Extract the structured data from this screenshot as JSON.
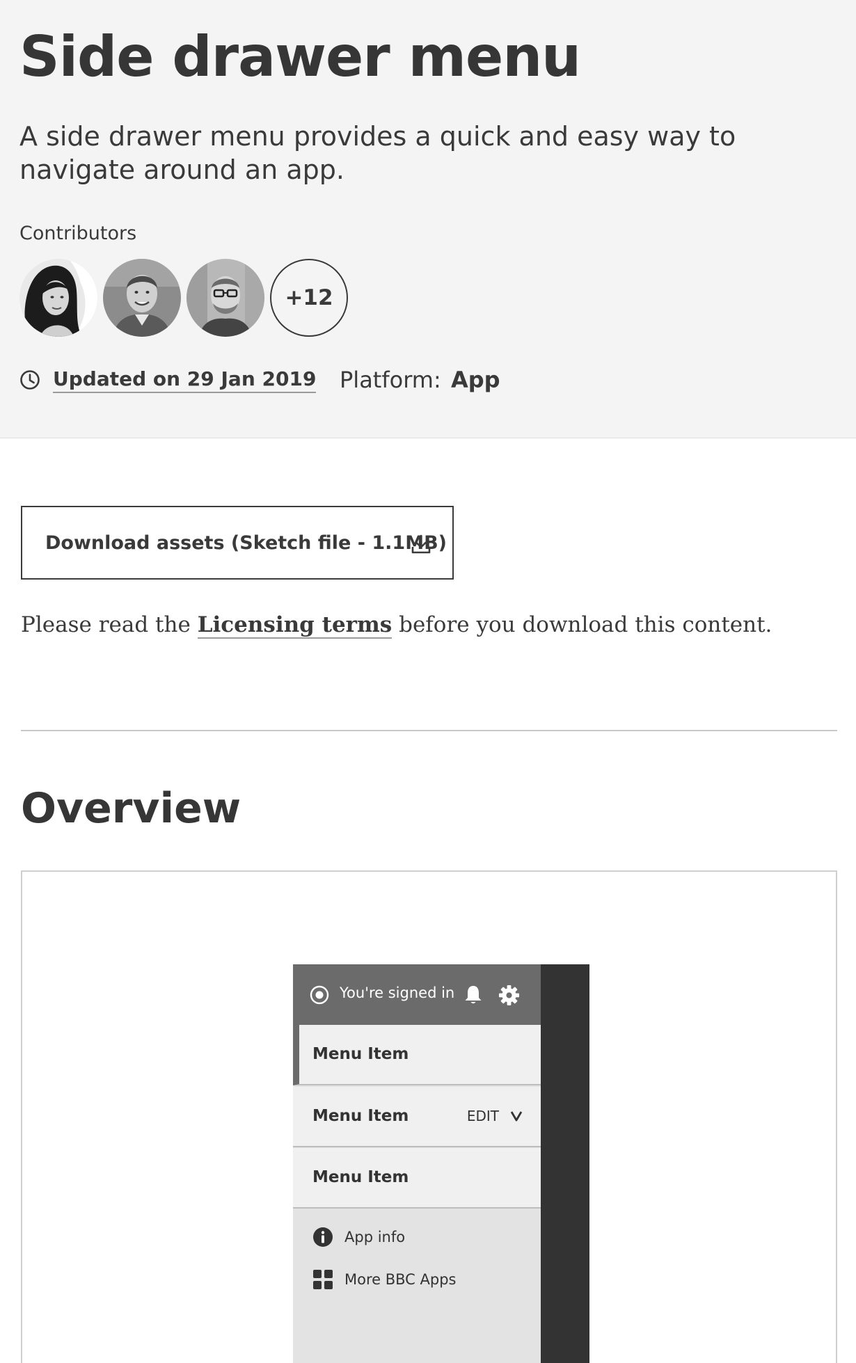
{
  "header": {
    "title": "Side drawer menu",
    "description": "A side drawer menu provides a quick and easy way to navigate around an app.",
    "contributors_label": "Contributors",
    "contributors_more": "+12",
    "updated_text": "Updated on 29 Jan 2019",
    "platform_label": "Platform:",
    "platform_value": "App"
  },
  "download": {
    "label": "Download assets (Sketch file - 1.1MB)"
  },
  "license": {
    "before": "Please read the ",
    "link": "Licensing terms",
    "after": " before you download this content."
  },
  "overview": {
    "title": "Overview"
  },
  "drawer": {
    "signed_in": "You're signed in",
    "menu_items": [
      {
        "label": "Menu Item"
      },
      {
        "label": "Menu Item",
        "action": "EDIT"
      },
      {
        "label": "Menu Item"
      }
    ],
    "footer_links": [
      {
        "label": "App info",
        "icon": "info-icon"
      },
      {
        "label": "More BBC Apps",
        "icon": "apps-grid-icon"
      }
    ]
  },
  "colors": {
    "hero_bg": "#f4f4f4",
    "text": "#3a3a3a",
    "drawer_header": "#6b6b6b",
    "drawer_overlay": "#333333",
    "menu_item_bg": "#f0f0f0",
    "drawer_footer_bg": "#e3e3e3"
  }
}
